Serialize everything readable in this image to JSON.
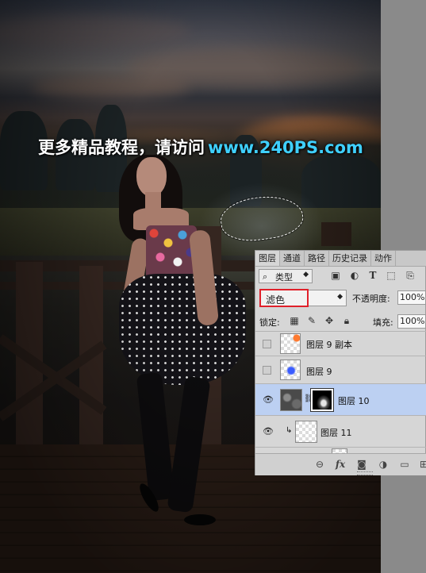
{
  "watermark": {
    "text_cn": "更多精品教程，请访问",
    "url": "www.240PS.com"
  },
  "layers_panel": {
    "tabs": [
      "图层",
      "通道",
      "路径",
      "历史记录",
      "动作"
    ],
    "active_tab": "图层",
    "filter": {
      "kind_label": "类型",
      "icons": [
        "image-filter-icon",
        "adjustment-filter-icon",
        "type-filter-icon",
        "shape-filter-icon",
        "smart-object-filter-icon"
      ],
      "type_icon_glyph": "T"
    },
    "blend_mode": "滤色",
    "opacity_label": "不透明度:",
    "opacity_value": "100%",
    "lock_label": "锁定:",
    "fill_label": "填充:",
    "fill_value": "100%",
    "layers": [
      {
        "name": "图层 9 副本",
        "visible": false,
        "selected": false
      },
      {
        "name": "图层 9",
        "visible": false,
        "selected": false
      },
      {
        "name": "图层 10",
        "visible": true,
        "selected": true,
        "has_mask": true
      },
      {
        "name": "图层 11",
        "visible": true,
        "selected": false,
        "clipped": true
      }
    ],
    "bottom_icons": [
      "link-icon",
      "fx-icon",
      "mask-icon",
      "adjustment-icon",
      "folder-icon",
      "new-layer-icon"
    ],
    "fx_label": "fx"
  },
  "colors": {
    "selection_highlight": "#bcd0f2",
    "red_highlight": "#e0202a",
    "watermark_url": "#3fd0ff"
  }
}
